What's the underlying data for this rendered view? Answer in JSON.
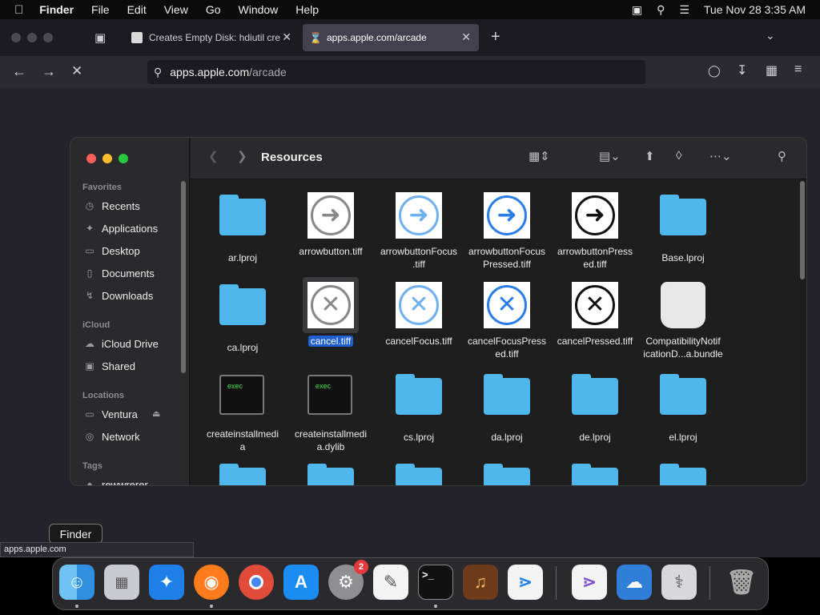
{
  "menubar": {
    "app": "Finder",
    "items": [
      "File",
      "Edit",
      "View",
      "Go",
      "Window",
      "Help"
    ],
    "datetime": "Tue Nov 28  3:35 AM"
  },
  "browser": {
    "tabs": [
      {
        "title": "Creates Empty Disk: hdiutil cre",
        "active": false
      },
      {
        "title": "apps.apple.com/arcade",
        "active": true
      }
    ],
    "url_host": "apps.apple.com",
    "url_path": "/arcade",
    "status_text": "apps.apple.com"
  },
  "finder": {
    "title": "Resources",
    "sidebar": {
      "favorites_header": "Favorites",
      "favorites": [
        "Recents",
        "Applications",
        "Desktop",
        "Documents",
        "Downloads"
      ],
      "icloud_header": "iCloud",
      "icloud": [
        "iCloud Drive",
        "Shared"
      ],
      "locations_header": "Locations",
      "locations": [
        "Ventura",
        "Network"
      ],
      "tags_header": "Tags",
      "tags": [
        "rewwrerer"
      ]
    },
    "files": [
      {
        "name1": "ar.lproj",
        "name2": "",
        "kind": "folder"
      },
      {
        "name1": "arrowbutton.tiff",
        "name2": "",
        "kind": "tiff-arrow-gray"
      },
      {
        "name1": "arrowbuttonFocus",
        "name2": ".tiff",
        "kind": "tiff-arrow-lightblue"
      },
      {
        "name1": "arrowbuttonFocus",
        "name2": "Pressed.tiff",
        "kind": "tiff-arrow-blue"
      },
      {
        "name1": "arrowbuttonPress",
        "name2": "ed.tiff",
        "kind": "tiff-arrow-black"
      },
      {
        "name1": "Base.lproj",
        "name2": "",
        "kind": "folder"
      },
      {
        "name1": "ca.lproj",
        "name2": "",
        "kind": "folder"
      },
      {
        "name1": "cancel.tiff",
        "name2": "",
        "kind": "tiff-x-gray",
        "selected": true
      },
      {
        "name1": "cancelFocus.tiff",
        "name2": "",
        "kind": "tiff-x-lightblue"
      },
      {
        "name1": "cancelFocusPress",
        "name2": "ed.tiff",
        "kind": "tiff-x-blue"
      },
      {
        "name1": "cancelPressed.tiff",
        "name2": "",
        "kind": "tiff-x-black"
      },
      {
        "name1": "CompatibilityNotif",
        "name2": "icationD...a.bundle",
        "kind": "bundle"
      },
      {
        "name1": "createinstallmedi",
        "name2": "a",
        "kind": "exec"
      },
      {
        "name1": "createinstallmedi",
        "name2": "a.dylib",
        "kind": "exec"
      },
      {
        "name1": "cs.lproj",
        "name2": "",
        "kind": "folder"
      },
      {
        "name1": "da.lproj",
        "name2": "",
        "kind": "folder"
      },
      {
        "name1": "de.lproj",
        "name2": "",
        "kind": "folder"
      },
      {
        "name1": "el.lproj",
        "name2": "",
        "kind": "folder"
      }
    ],
    "exec_label": "exec"
  },
  "tooltip": "Finder",
  "dock": {
    "apps": [
      "Finder",
      "Launchpad",
      "Safari",
      "Firefox",
      "Chrome",
      "App Store",
      "System Settings",
      "TextEdit",
      "Terminal",
      "GarageBand",
      "Visual Studio Code",
      "Visual Studio",
      "Weather",
      "Disk Utility",
      "Trash"
    ],
    "settings_badge": "2"
  },
  "colors": {
    "accent": "#1f5fcf",
    "folder": "#4fb7ec",
    "dock_badge": "#e5393b"
  }
}
